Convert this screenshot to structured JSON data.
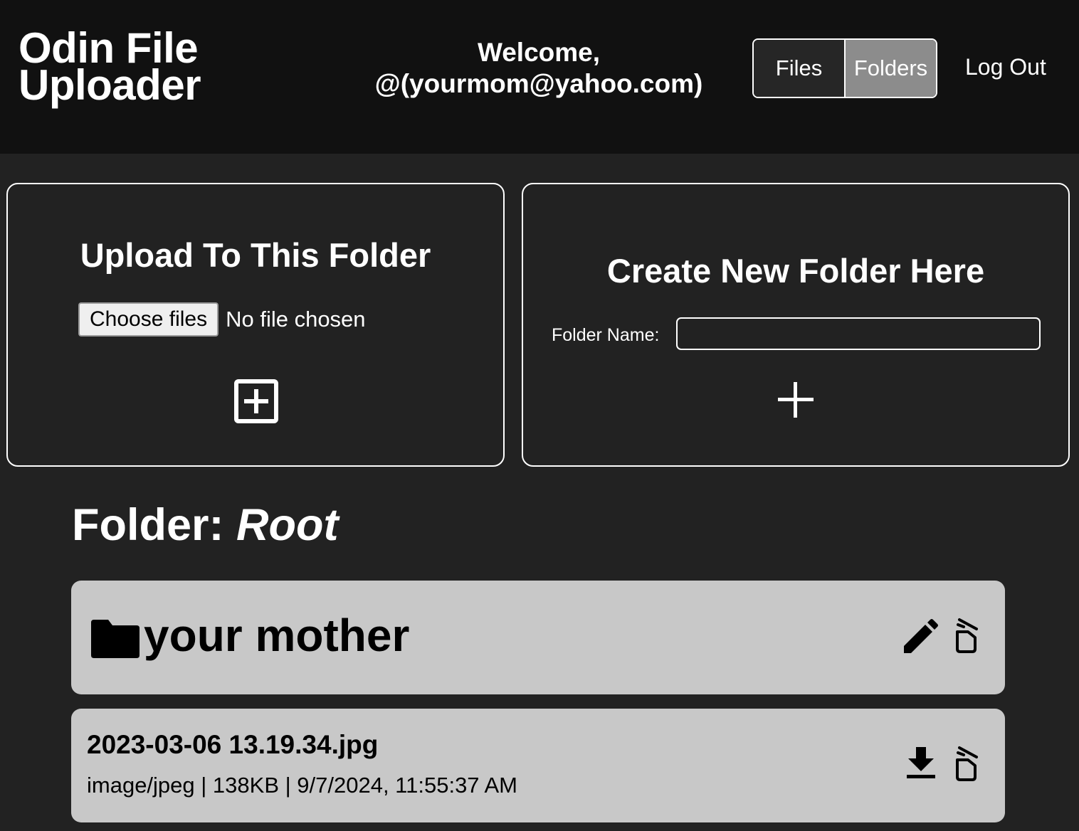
{
  "header": {
    "logo_line1": "Odin File",
    "logo_line2": "Uploader",
    "welcome_line1": "Welcome,",
    "welcome_line2": "@(yourmom@yahoo.com)",
    "nav": {
      "files_label": "Files",
      "folders_label": "Folders",
      "active": "Folders"
    },
    "logout_label": "Log Out"
  },
  "upload_panel": {
    "title": "Upload To This Folder",
    "choose_button_label": "Choose files",
    "file_status": "No file chosen",
    "submit_icon": "plus-square-icon"
  },
  "create_panel": {
    "title": "Create New Folder Here",
    "folder_name_label": "Folder Name:",
    "folder_name_value": "",
    "submit_icon": "plus-icon"
  },
  "current_folder": {
    "prefix": "Folder: ",
    "name": "Root"
  },
  "items": {
    "folders": [
      {
        "name": "your mother",
        "icon": "folder-icon",
        "actions": [
          "pencil-icon",
          "trash-icon"
        ]
      }
    ],
    "files": [
      {
        "name": "2023-03-06 13.19.34.jpg",
        "meta": "image/jpeg | 138KB | 9/7/2024, 11:55:37 AM",
        "actions": [
          "download-icon",
          "trash-icon"
        ]
      }
    ]
  },
  "colors": {
    "header_bg": "#111111",
    "page_bg": "#222222",
    "card_bg": "#c8c8c8",
    "active_tab_bg": "#8c8c8c",
    "inactive_tab_bg": "#262626",
    "text_light": "#ffffff",
    "text_dark": "#000000"
  }
}
